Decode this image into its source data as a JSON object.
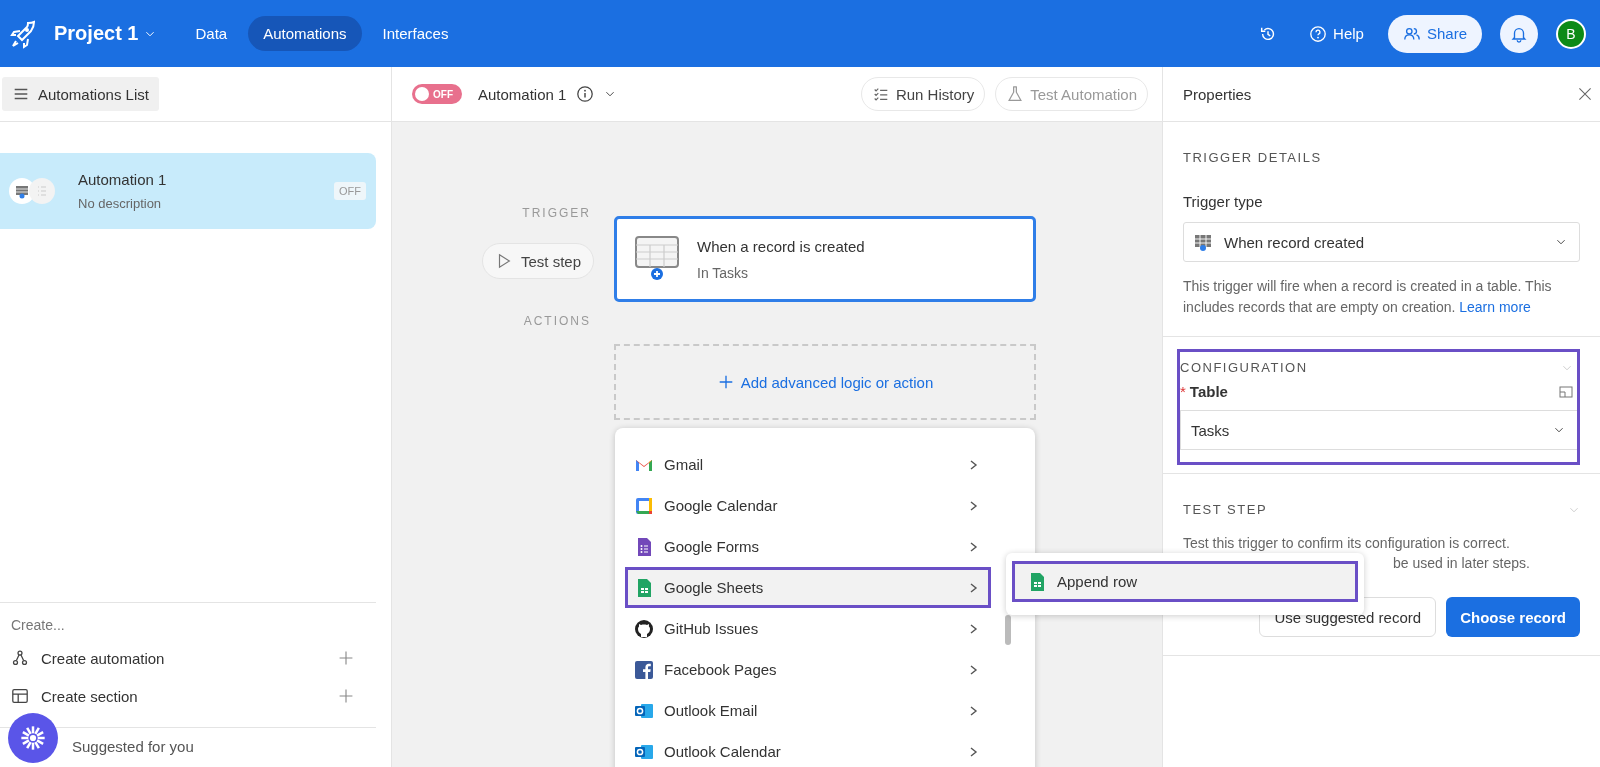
{
  "header": {
    "project": "Project 1",
    "nav": [
      {
        "label": "Data",
        "selected": false
      },
      {
        "label": "Automations",
        "selected": true
      },
      {
        "label": "Interfaces",
        "selected": false
      }
    ],
    "help": "Help",
    "share": "Share",
    "avatar": "B"
  },
  "sidebar": {
    "list_button": "Automations List",
    "automations": [
      {
        "name": "Automation 1",
        "description": "No description",
        "status": "OFF",
        "selected": true
      }
    ],
    "create_heading": "Create...",
    "create_items": [
      {
        "label": "Create automation",
        "kind": "automation"
      },
      {
        "label": "Create section",
        "kind": "section"
      }
    ],
    "suggested": "Suggested for you"
  },
  "toolbar": {
    "toggle": {
      "label": "OFF",
      "on": false
    },
    "title": "Automation 1",
    "run_history": "Run History",
    "test_automation": {
      "label": "Test Automation",
      "disabled": true
    }
  },
  "canvas": {
    "trigger_label": "TRIGGER",
    "test_step": "Test step",
    "trigger_card": {
      "title": "When a record is created",
      "subtitle": "In Tasks",
      "selected": true
    },
    "actions_label": "ACTIONS",
    "add_action": "Add advanced logic or action"
  },
  "menu": {
    "items": [
      {
        "label": "Gmail",
        "kind": "gmail",
        "highlighted": false
      },
      {
        "label": "Google Calendar",
        "kind": "calendar",
        "highlighted": false
      },
      {
        "label": "Google Forms",
        "kind": "forms",
        "highlighted": false
      },
      {
        "label": "Google Sheets",
        "kind": "sheets",
        "highlighted": true
      },
      {
        "label": "GitHub Issues",
        "kind": "github",
        "highlighted": false
      },
      {
        "label": "Facebook Pages",
        "kind": "facebook",
        "highlighted": false
      },
      {
        "label": "Outlook Email",
        "kind": "outlook",
        "highlighted": false
      },
      {
        "label": "Outlook Calendar",
        "kind": "outlook",
        "highlighted": false
      }
    ],
    "submenu": [
      {
        "label": "Append row",
        "kind": "sheets",
        "highlighted": true
      }
    ]
  },
  "properties": {
    "title": "Properties",
    "trigger_details": {
      "heading": "TRIGGER DETAILS",
      "type_label": "Trigger type",
      "type_value": "When record created",
      "description": "This trigger will fire when a record is created in a table. This includes records that are empty on creation.",
      "link": "Learn more"
    },
    "configuration": {
      "heading": "CONFIGURATION",
      "highlighted": true,
      "field_label": "Table",
      "required_mark": "*",
      "field_value": "Tasks"
    },
    "test_step": {
      "heading": "TEST STEP",
      "line_1": "Test this trigger to confirm its configuration is correct.",
      "line_2": "be used in later steps.",
      "secondary_button": "Use suggested record",
      "primary_button": "Choose record"
    }
  }
}
